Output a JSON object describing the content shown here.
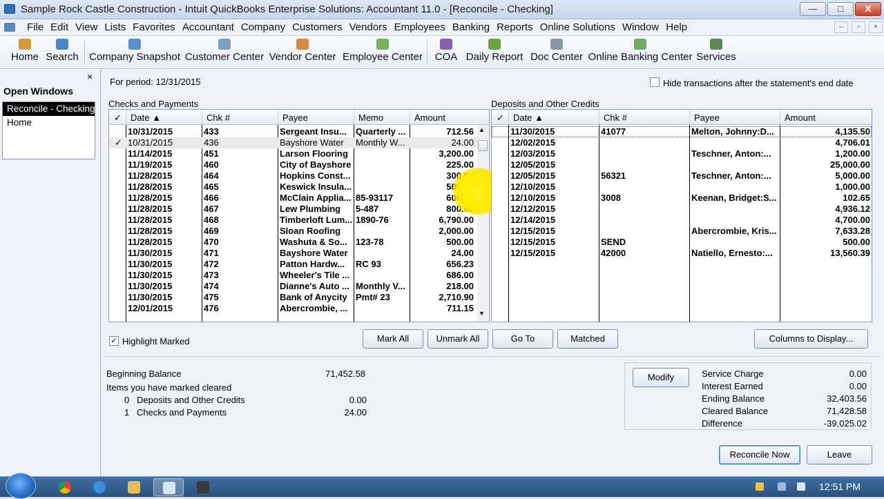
{
  "titlebar": {
    "title": "Sample Rock Castle Construction  - Intuit QuickBooks Enterprise Solutions: Accountant 11.0 - [Reconcile - Checking]",
    "min": "—",
    "max": "□",
    "close": "X"
  },
  "menubar": {
    "items": [
      "File",
      "Edit",
      "View",
      "Lists",
      "Favorites",
      "Accountant",
      "Company",
      "Customers",
      "Vendors",
      "Employees",
      "Banking",
      "Reports",
      "Online Solutions",
      "Window",
      "Help"
    ],
    "mdi_min": "–",
    "mdi_restore": "▫",
    "mdi_close": "×"
  },
  "toolbar": {
    "items": [
      {
        "label": "Home",
        "icon": "home-icon",
        "color": "#d79a3a"
      },
      {
        "label": "Search",
        "icon": "search-icon",
        "color": "#4d84c9"
      },
      {
        "label": "Company Snapshot",
        "icon": "snapshot-icon",
        "color": "#5d8fd0"
      },
      {
        "label": "Customer Center",
        "icon": "customer-icon",
        "color": "#7aa0c7"
      },
      {
        "label": "Vendor Center",
        "icon": "vendor-icon",
        "color": "#d98b43"
      },
      {
        "label": "Employee Center",
        "icon": "employee-icon",
        "color": "#7ab15d"
      },
      {
        "label": "COA",
        "icon": "coa-icon",
        "color": "#8a5fb0"
      },
      {
        "label": "Daily Report",
        "icon": "report-icon",
        "color": "#6aa33e"
      },
      {
        "label": "Doc Center",
        "icon": "doc-icon",
        "color": "#8c96a6"
      },
      {
        "label": "Online Banking Center",
        "icon": "banking-icon",
        "color": "#74a86b"
      },
      {
        "label": "Services",
        "icon": "services-icon",
        "color": "#5a8a5a"
      }
    ]
  },
  "open_windows": {
    "title": "Open Windows",
    "close": "×",
    "items": [
      "Reconcile - Checking",
      "Home"
    ]
  },
  "reconcile": {
    "period_label": "For period: 12/31/2015",
    "hide_label": "Hide transactions after the statement's end date",
    "checks": {
      "title": "Checks and Payments",
      "headers": {
        "check": "✓",
        "date": "Date  ▲",
        "chk": "Chk #",
        "payee": "Payee",
        "memo": "Memo",
        "amount": "Amount"
      },
      "rows": [
        {
          "mark": "",
          "date": "10/31/2015",
          "chk": "433",
          "payee": "Sergeant Insu...",
          "memo": "Quarterly ...",
          "amount": "712.56"
        },
        {
          "mark": "✓",
          "date": "10/31/2015",
          "chk": "436",
          "payee": "Bayshore Water",
          "memo": "Monthly W...",
          "amount": "24.00"
        },
        {
          "mark": "",
          "date": "11/14/2015",
          "chk": "451",
          "payee": "Larson Flooring",
          "memo": "",
          "amount": "3,200.00"
        },
        {
          "mark": "",
          "date": "11/19/2015",
          "chk": "460",
          "payee": "City of Bayshore",
          "memo": "",
          "amount": "225.00"
        },
        {
          "mark": "",
          "date": "11/28/2015",
          "chk": "464",
          "payee": "Hopkins Const...",
          "memo": "",
          "amount": "300.00"
        },
        {
          "mark": "",
          "date": "11/28/2015",
          "chk": "465",
          "payee": "Keswick Insula...",
          "memo": "",
          "amount": "500.00"
        },
        {
          "mark": "",
          "date": "11/28/2015",
          "chk": "466",
          "payee": "McClain Applia...",
          "memo": "85-93117",
          "amount": "600.00"
        },
        {
          "mark": "",
          "date": "11/28/2015",
          "chk": "467",
          "payee": "Lew Plumbing",
          "memo": "5-487",
          "amount": "800.00"
        },
        {
          "mark": "",
          "date": "11/28/2015",
          "chk": "468",
          "payee": "Timberloft Lum...",
          "memo": "1890-76",
          "amount": "6,790.00"
        },
        {
          "mark": "",
          "date": "11/28/2015",
          "chk": "469",
          "payee": "Sloan Roofing",
          "memo": "",
          "amount": "2,000.00"
        },
        {
          "mark": "",
          "date": "11/28/2015",
          "chk": "470",
          "payee": "Washuta & So...",
          "memo": "123-78",
          "amount": "500.00"
        },
        {
          "mark": "",
          "date": "11/30/2015",
          "chk": "471",
          "payee": "Bayshore Water",
          "memo": "",
          "amount": "24.00"
        },
        {
          "mark": "",
          "date": "11/30/2015",
          "chk": "472",
          "payee": "Patton Hardw...",
          "memo": "RC 93",
          "amount": "656.23"
        },
        {
          "mark": "",
          "date": "11/30/2015",
          "chk": "473",
          "payee": "Wheeler's Tile ...",
          "memo": "",
          "amount": "686.00"
        },
        {
          "mark": "",
          "date": "11/30/2015",
          "chk": "474",
          "payee": "Dianne's Auto ...",
          "memo": "Monthly V...",
          "amount": "218.00"
        },
        {
          "mark": "",
          "date": "11/30/2015",
          "chk": "475",
          "payee": "Bank of Anycity",
          "memo": "Pmt# 23",
          "amount": "2,710.90"
        },
        {
          "mark": "",
          "date": "12/01/2015",
          "chk": "476",
          "payee": "Abercrombie, ...",
          "memo": "",
          "amount": "711.15"
        }
      ]
    },
    "deposits": {
      "title": "Deposits and Other Credits",
      "headers": {
        "check": "✓",
        "date": "Date  ▲",
        "chk": "Chk #",
        "payee": "Payee",
        "amount": "Amount"
      },
      "rows": [
        {
          "date": "11/30/2015",
          "chk": "41077",
          "payee": "Melton, Johnny:D...",
          "amount": "4,135.50"
        },
        {
          "date": "12/02/2015",
          "chk": "",
          "payee": "",
          "amount": "4,706.01"
        },
        {
          "date": "12/03/2015",
          "chk": "",
          "payee": "Teschner, Anton:...",
          "amount": "1,200.00"
        },
        {
          "date": "12/05/2015",
          "chk": "",
          "payee": "",
          "amount": "25,000.00"
        },
        {
          "date": "12/05/2015",
          "chk": "56321",
          "payee": "Teschner, Anton:...",
          "amount": "5,000.00"
        },
        {
          "date": "12/10/2015",
          "chk": "",
          "payee": "",
          "amount": "1,000.00"
        },
        {
          "date": "12/10/2015",
          "chk": "3008",
          "payee": "Keenan, Bridget:S...",
          "amount": "102.65"
        },
        {
          "date": "12/12/2015",
          "chk": "",
          "payee": "",
          "amount": "4,936.12"
        },
        {
          "date": "12/14/2015",
          "chk": "",
          "payee": "",
          "amount": "4,700.00"
        },
        {
          "date": "12/15/2015",
          "chk": "",
          "payee": "Abercrombie, Kris...",
          "amount": "7,633.28"
        },
        {
          "date": "12/15/2015",
          "chk": "SEND",
          "payee": "",
          "amount": "500.00"
        },
        {
          "date": "12/15/2015",
          "chk": "42000",
          "payee": "Natiello, Ernesto:...",
          "amount": "13,560.39"
        }
      ]
    },
    "highlight_marked_label": "Highlight Marked",
    "buttons": {
      "mark_all": "Mark All",
      "unmark_all": "Unmark All",
      "go_to": "Go To",
      "matched": "Matched",
      "columns": "Columns to Display...",
      "modify": "Modify",
      "reconcile_now": "Reconcile Now",
      "leave": "Leave"
    },
    "summary": {
      "beginning_balance_label": "Beginning Balance",
      "beginning_balance": "71,452.58",
      "items_marked_label": "Items you have marked cleared",
      "deposits_count": "0",
      "deposits_label": "Deposits and Other Credits",
      "deposits_total": "0.00",
      "checks_count": "1",
      "checks_label": "Checks and Payments",
      "checks_total": "24.00",
      "service_charge_label": "Service Charge",
      "service_charge": "0.00",
      "interest_earned_label": "Interest Earned",
      "interest_earned": "0.00",
      "ending_balance_label": "Ending Balance",
      "ending_balance": "32,403.56",
      "cleared_balance_label": "Cleared Balance",
      "cleared_balance": "71,428.58",
      "difference_label": "Difference",
      "difference": "-39,025.02"
    }
  },
  "taskbar": {
    "clock": "12:51 PM",
    "apps": [
      "chrome-icon",
      "ie-icon",
      "explorer-icon",
      "quickbooks-icon",
      "bookkeeper-icon"
    ]
  }
}
